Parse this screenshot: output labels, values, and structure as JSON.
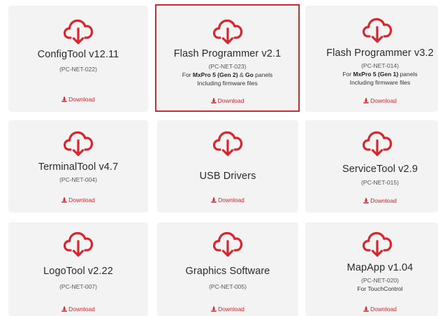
{
  "colors": {
    "accent": "#d7262e",
    "card_bg": "#f3f3f3",
    "selected_border": "#d7262e"
  },
  "download_label": "Download",
  "products": [
    {
      "title": "ConfigTool v12.11",
      "code": "(PC-NET-022)",
      "desc_lines": [],
      "selected": false
    },
    {
      "title": "Flash Programmer v2.1",
      "code": "(PC-NET-023)",
      "desc_line1": {
        "pre": "For ",
        "bold1": "MxPro 5 (Gen 2)",
        "mid": " & ",
        "bold2": "Go",
        "post": " panels"
      },
      "desc_line2": "Including firmware files",
      "selected": true
    },
    {
      "title": "Flash Programmer v3.2",
      "code": "(PC-NET-014)",
      "desc_line1": {
        "pre": "For ",
        "bold1": "MxPro 5 (Gen 1)",
        "post": " panels"
      },
      "desc_line2": "Including firmware files",
      "selected": false
    },
    {
      "title": "TerminalTool v4.7",
      "code": "(PC-NET-004)",
      "selected": false
    },
    {
      "title": "USB Drivers",
      "code": "",
      "selected": false
    },
    {
      "title": "ServiceTool v2.9",
      "code": "(PC-NET-015)",
      "selected": false
    },
    {
      "title": "LogoTool v2.22",
      "code": "(PC-NET-007)",
      "selected": false
    },
    {
      "title": "Graphics Software",
      "code": "(PC-NET-005)",
      "selected": false
    },
    {
      "title": "MapApp v1.04",
      "code": "(PC-NET-020)",
      "desc_line2": "For TouchControl",
      "selected": false
    }
  ]
}
